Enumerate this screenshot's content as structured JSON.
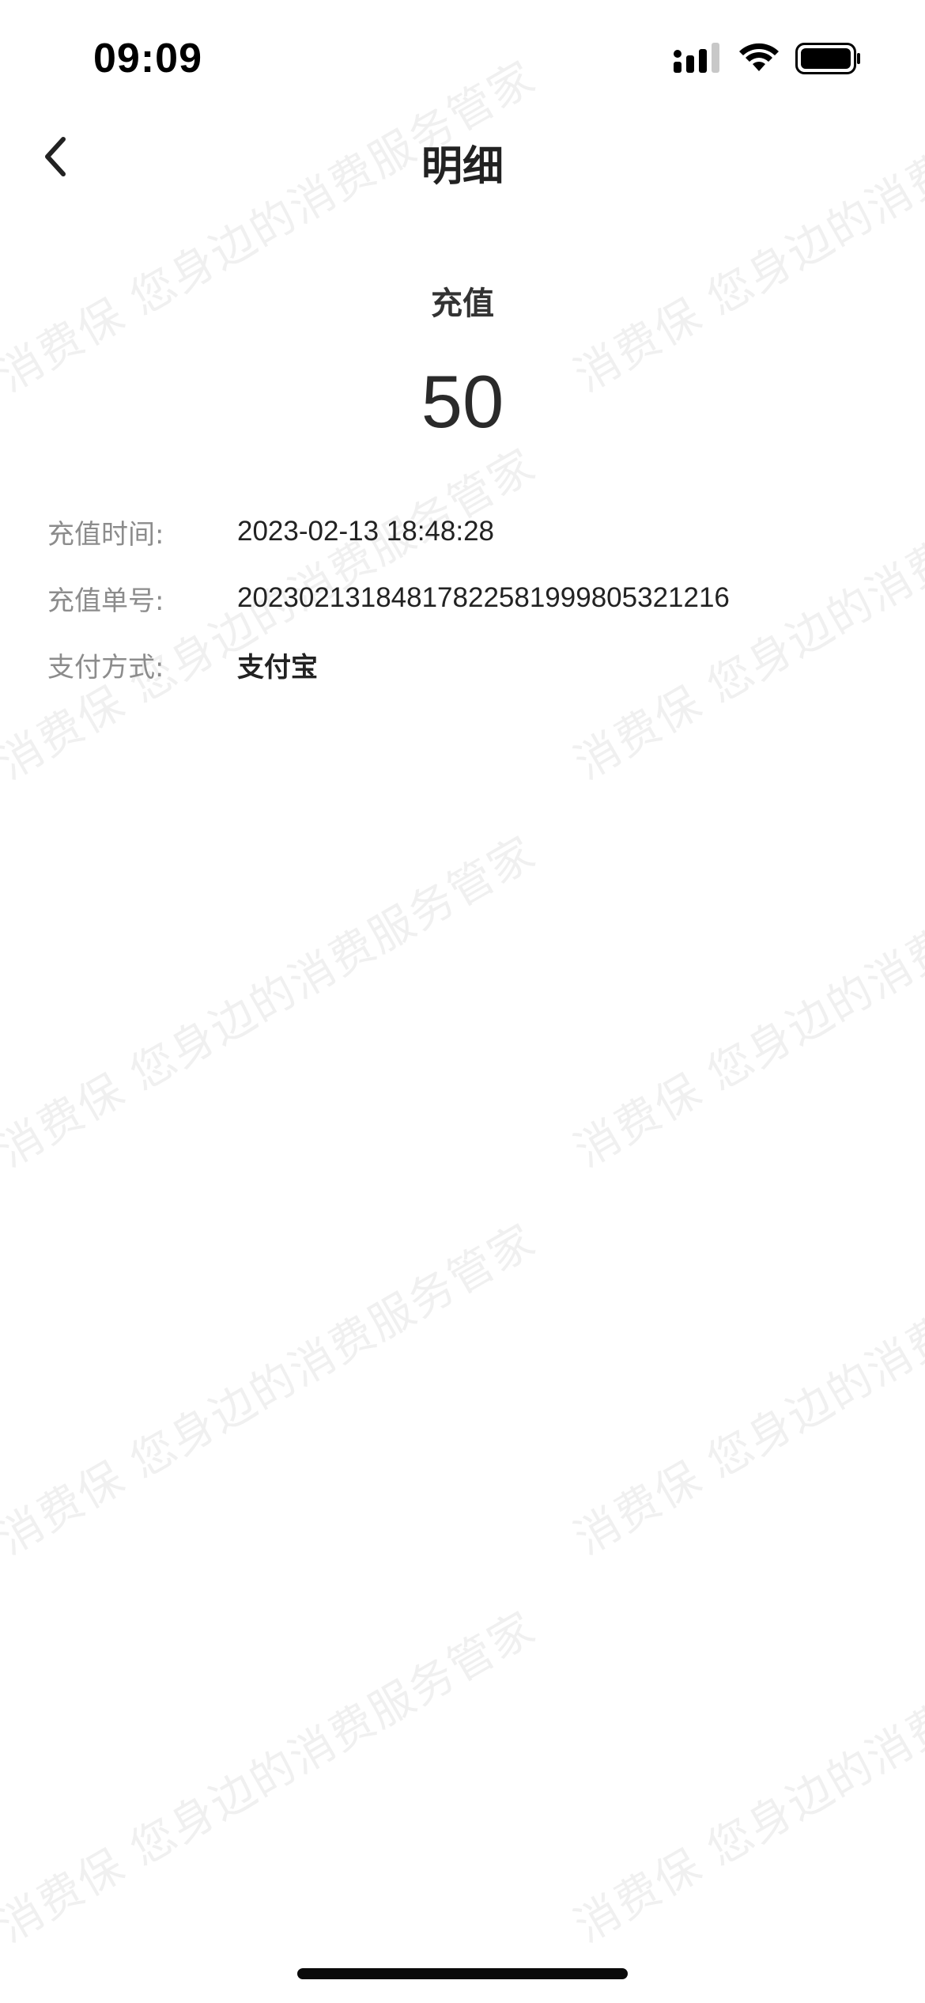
{
  "status_bar": {
    "time": "09:09",
    "icons": [
      "cellular-signal-icon",
      "wifi-icon",
      "battery-icon"
    ]
  },
  "nav": {
    "title": "明细",
    "back_icon": "chevron-left-icon"
  },
  "summary": {
    "type": "充值",
    "amount": "50"
  },
  "details": [
    {
      "label": "充值时间:",
      "value": "2023-02-13 18:48:28"
    },
    {
      "label": "充值单号:",
      "value": "20230213184817822581999805321216"
    },
    {
      "label": "支付方式:",
      "value": "支付宝"
    }
  ],
  "watermark": {
    "text": "消费保 您身边的消费服务管家"
  },
  "colors": {
    "text_primary": "#222222",
    "text_secondary": "#8c8c8c",
    "background": "#ffffff"
  }
}
